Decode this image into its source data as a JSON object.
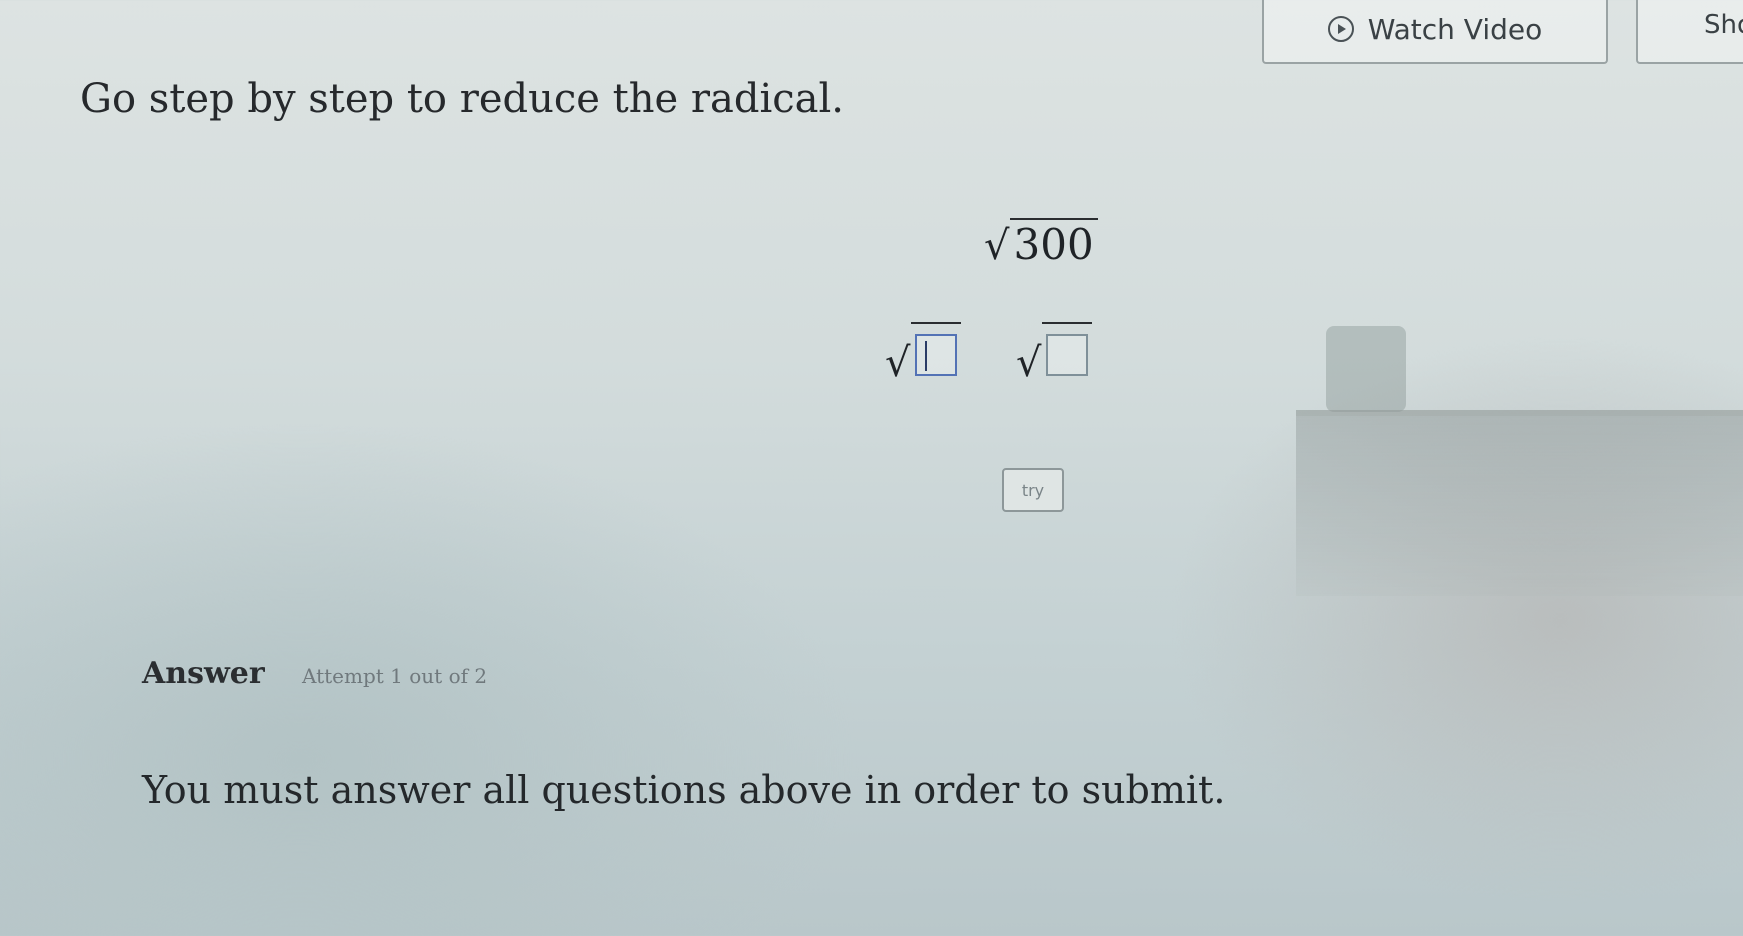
{
  "toolbar": {
    "watch_video_label": "Watch Video",
    "show_label": "Sho",
    "play_icon": "play-circle-icon"
  },
  "question": {
    "prompt": "Go step by step to reduce the radical.",
    "radicand": "300",
    "surd_symbol": "√"
  },
  "inputs": {
    "box_a_value": "",
    "box_b_value": ""
  },
  "try_button": {
    "label": "try"
  },
  "answer": {
    "label": "Answer",
    "attempt": "Attempt 1 out of 2",
    "submit_message": "You must answer all questions above in order to submit."
  }
}
